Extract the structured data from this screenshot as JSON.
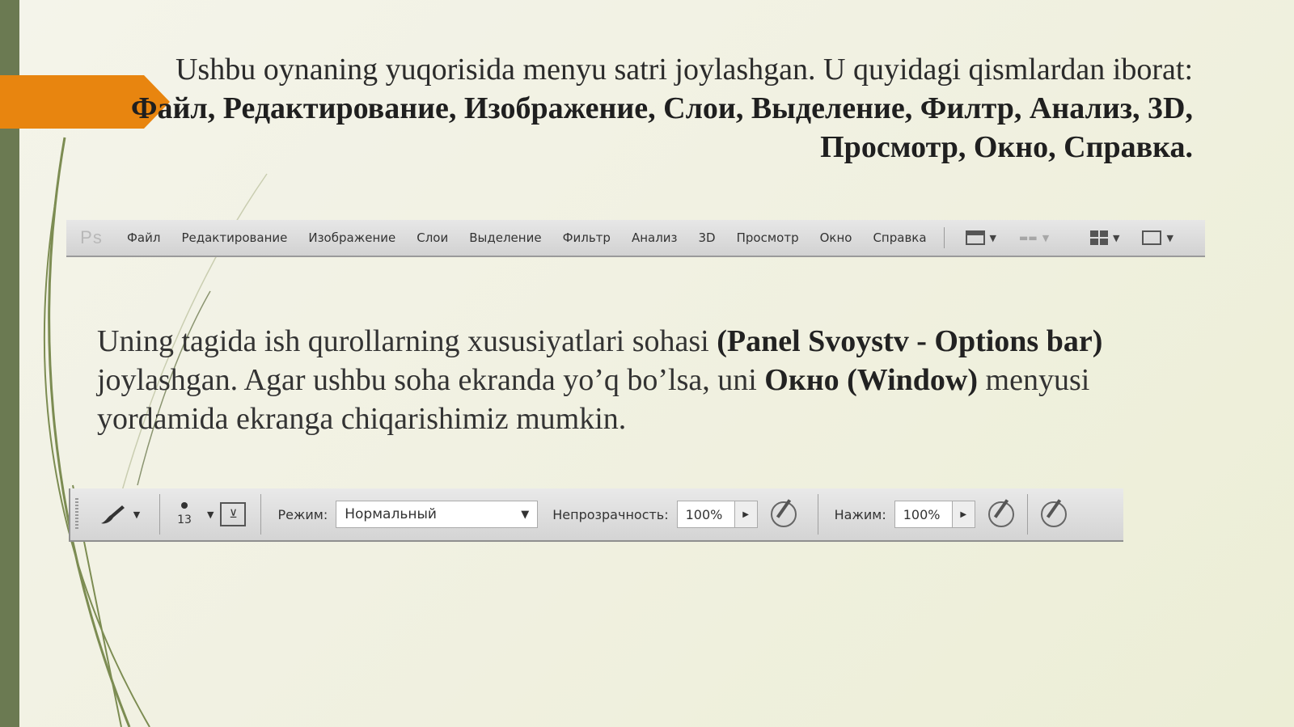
{
  "slide": {
    "heading_plain": "Ushbu oynaning yuqorisida menyu satri joylashgan. U quyidagi qismlardan iborat:",
    "heading_bold": "Файл, Редактирование, Изображение, Слои, Выделение, Филтр, Анализ, 3D, Просмотр, Окно, Справка.",
    "para_part1": "Uning tagida ish qurollarning xususiyatlari sohasi ",
    "para_bold1": "(Panel Svoystv - Options bar)",
    "para_part2": " joylashgan. Agar ushbu soha ekranda yo’q bo’lsa, uni ",
    "para_bold2": "Окно (Window)",
    "para_part3": " menyusi yordamida ekranga chiqarishimiz mumkin."
  },
  "menubar": {
    "logo": "Ps",
    "items": [
      "Файл",
      "Редактирование",
      "Изображение",
      "Слои",
      "Выделение",
      "Фильтр",
      "Анализ",
      "3D",
      "Просмотр",
      "Окно",
      "Справка"
    ],
    "icons": [
      "window-layout-icon",
      "zoom-dropdown-icon",
      "arrange-icon",
      "screen-mode-icon"
    ]
  },
  "optionsbar": {
    "brush_size": "13",
    "mode_label": "Режим:",
    "mode_value": "Нормальный",
    "opacity_label": "Непрозрачность:",
    "opacity_value": "100%",
    "pressure_label": "Нажим:",
    "pressure_value": "100%"
  },
  "colors": {
    "accent": "#e8850f",
    "left_bar": "#6b7a52"
  }
}
